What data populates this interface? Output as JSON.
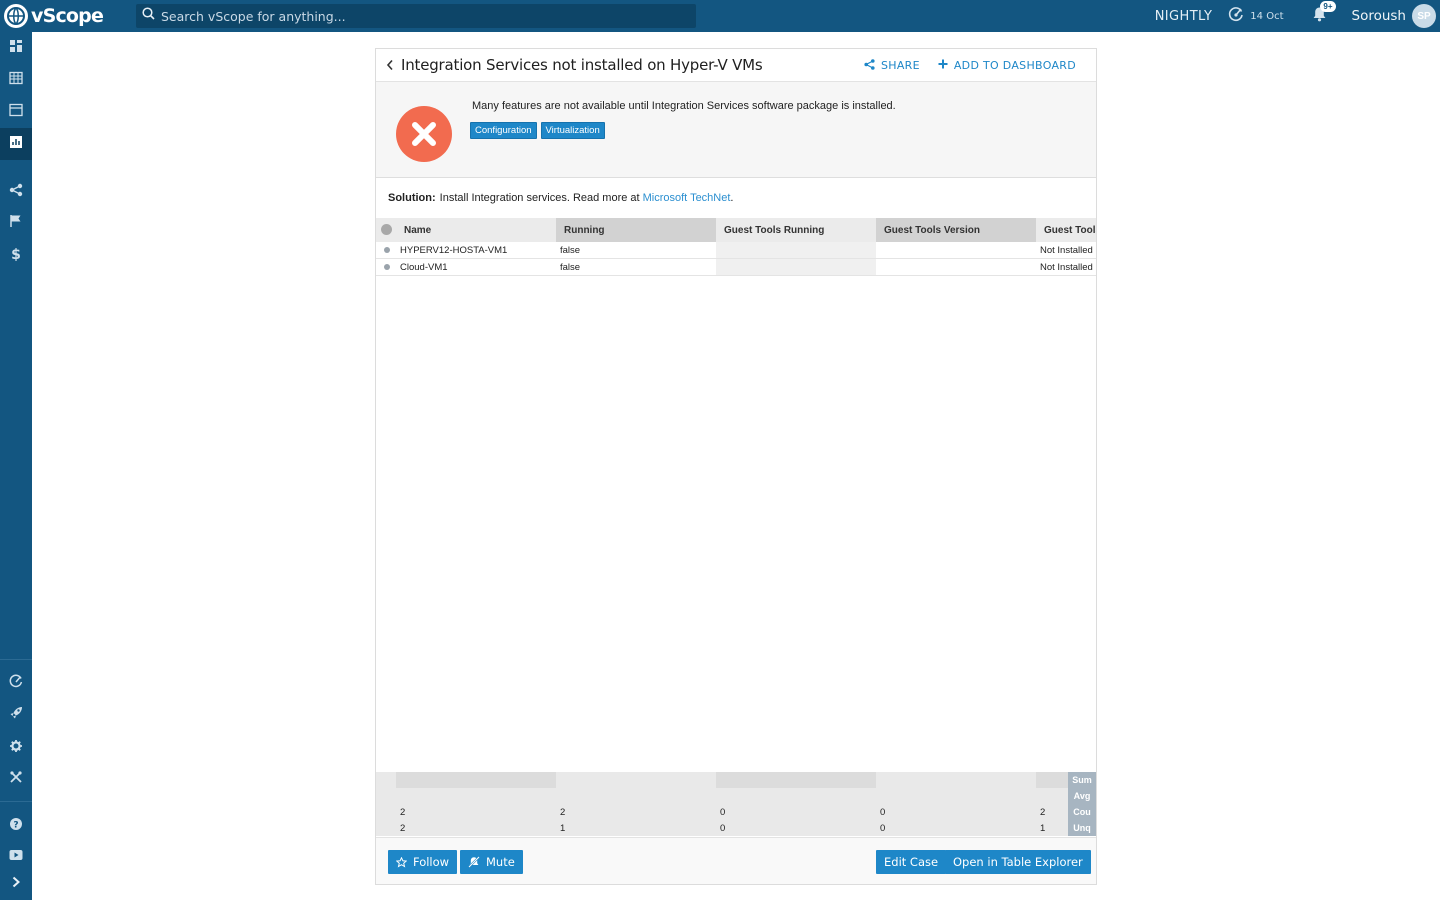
{
  "topbar": {
    "app_name": "vScope",
    "search_placeholder": "Search vScope for anything...",
    "environment": "NIGHTLY",
    "date": "14 Oct",
    "notification_badge": "9+",
    "user_name": "Soroush",
    "user_initials": "SP"
  },
  "sidebar": {
    "items": [
      {
        "name": "dashboard-icon"
      },
      {
        "name": "table-icon"
      },
      {
        "name": "window-icon"
      },
      {
        "name": "report-icon",
        "active": true
      },
      {
        "name": "share-icon"
      },
      {
        "name": "flag-icon"
      },
      {
        "name": "dollar-icon"
      },
      {
        "name": "gauge-icon"
      },
      {
        "name": "rocket-icon"
      },
      {
        "name": "gear-icon"
      },
      {
        "name": "tools-icon"
      },
      {
        "name": "help-icon"
      },
      {
        "name": "video-icon"
      },
      {
        "name": "expand-chevron-icon"
      }
    ]
  },
  "case": {
    "title": "Integration Services not installed on Hyper-V VMs",
    "share_label": "SHARE",
    "add_dashboard_label": "ADD TO DASHBOARD",
    "description": "Many features are not available until Integration Services software package is installed.",
    "tags": [
      "Configuration",
      "Virtualization"
    ],
    "solution_label": "Solution:",
    "solution_text": "Install Integration services. Read more at",
    "solution_link": "Microsoft TechNet",
    "solution_end": "."
  },
  "table": {
    "columns": [
      "Name",
      "Running",
      "Guest Tools Running",
      "Guest Tools Version",
      "Guest Tools"
    ],
    "rows": [
      [
        "HYPERV12-HOSTA-VM1",
        "false",
        "",
        "",
        "Not Installed"
      ],
      [
        "Cloud-VM1",
        "false",
        "",
        "",
        "Not Installed"
      ]
    ],
    "aggregates": [
      {
        "label": "Sum",
        "values": [
          "",
          "",
          "",
          "",
          ""
        ]
      },
      {
        "label": "Avg",
        "values": [
          "",
          "",
          "",
          "",
          ""
        ]
      },
      {
        "label": "Cou",
        "values": [
          "2",
          "2",
          "0",
          "0",
          "2"
        ]
      },
      {
        "label": "Unq",
        "values": [
          "2",
          "1",
          "0",
          "0",
          "1"
        ]
      }
    ]
  },
  "footer": {
    "follow_label": "Follow",
    "mute_label": "Mute",
    "edit_label": "Edit Case",
    "open_label": "Open in Table Explorer"
  },
  "colors": {
    "brand": "#135681",
    "accent": "#1e87c8",
    "error": "#f26b4f"
  }
}
